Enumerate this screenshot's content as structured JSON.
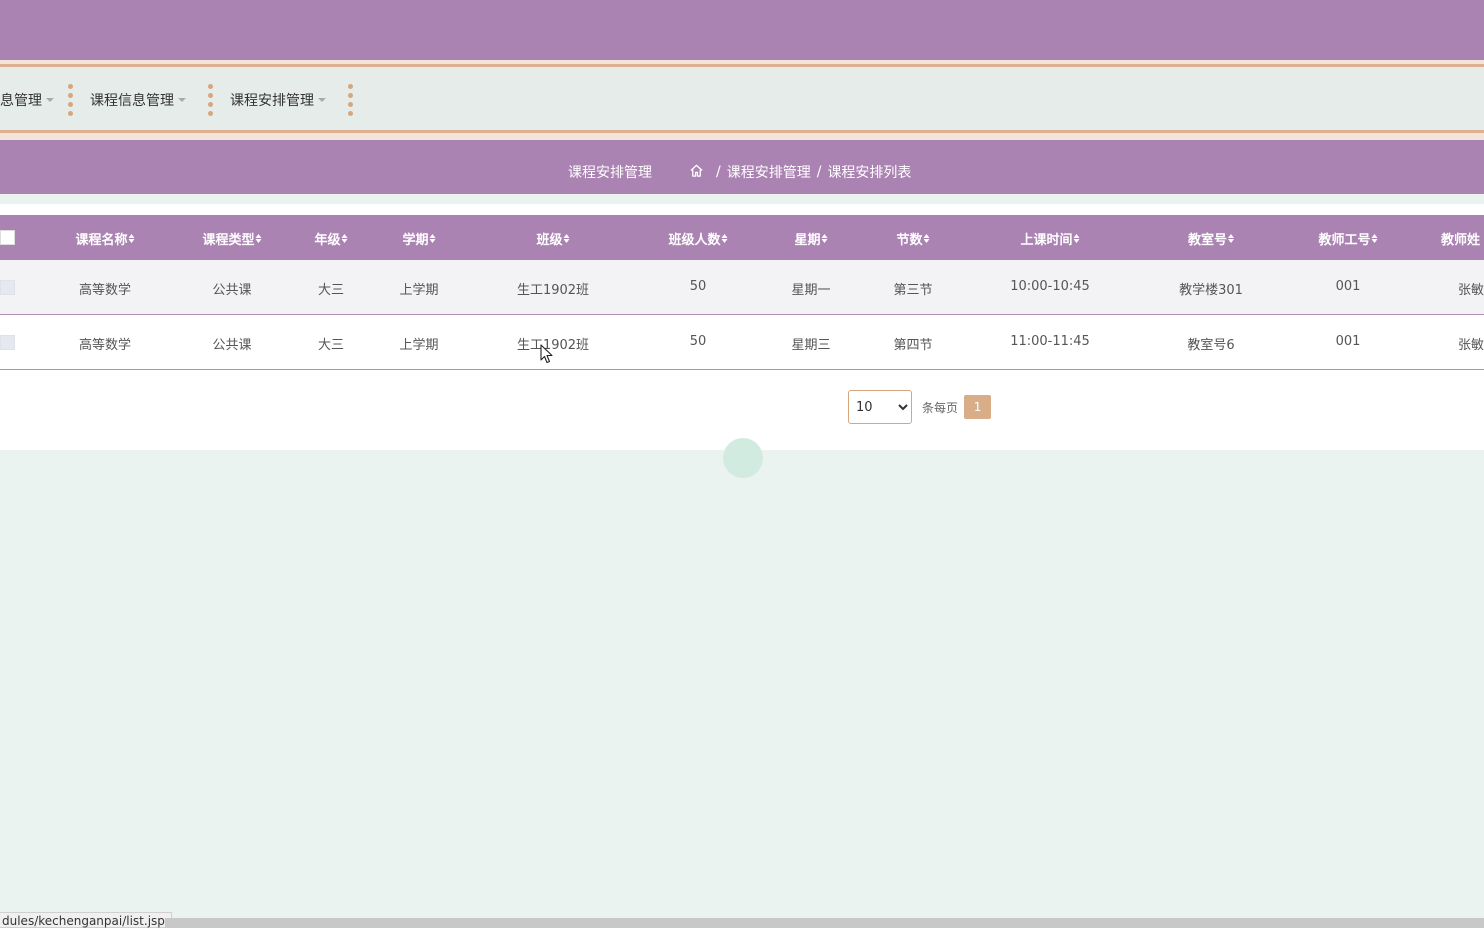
{
  "nav": {
    "items": [
      {
        "label": "息管理"
      },
      {
        "label": "课程信息管理"
      },
      {
        "label": "课程安排管理"
      }
    ]
  },
  "breadcrumb": {
    "title": "课程安排管理",
    "path": [
      "课程安排管理",
      "课程安排列表"
    ],
    "separator": "/"
  },
  "table": {
    "columns": [
      "课程名称",
      "课程类型",
      "年级",
      "学期",
      "班级",
      "班级人数",
      "星期",
      "节数",
      "上课时间",
      "教室号",
      "教师工号",
      "教师姓"
    ],
    "rows": [
      [
        "高等数学",
        "公共课",
        "大三",
        "上学期",
        "生工1902班",
        "50",
        "星期一",
        "第三节",
        "10:00-10:45",
        "教学楼301",
        "001",
        "张敏"
      ],
      [
        "高等数学",
        "公共课",
        "大三",
        "上学期",
        "生工1902班",
        "50",
        "星期三",
        "第四节",
        "11:00-11:45",
        "教室号6",
        "001",
        "张敏"
      ]
    ]
  },
  "pager": {
    "page_size": "10",
    "page_size_options": [
      "10"
    ],
    "per_page_label": "条每页",
    "current_page": "1"
  },
  "status_bar": {
    "url": "dules/kechenganpai/list.jsp"
  },
  "colors": {
    "primary": "#ab83b3",
    "accent": "#d6a77e",
    "nav_bg": "#e6ecea",
    "page_bg": "#eaf3ef"
  }
}
